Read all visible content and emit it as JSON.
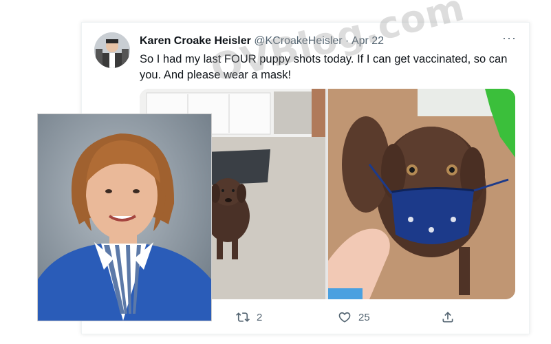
{
  "tweet": {
    "display_name": "Karen Croake Heisler",
    "handle": "@KCroakeHeisler",
    "separator": "·",
    "date": "Apr 22",
    "text": "So I had my last FOUR puppy shots today. If I can get vaccinated, so can you. And please wear a mask!",
    "more_icon": "···",
    "retweet_count": "2",
    "like_count": "25"
  },
  "icons": {
    "more": "more-icon",
    "retweet": "retweet-icon",
    "like": "heart-icon",
    "share": "share-icon"
  },
  "watermark": "OVBlog.com",
  "colors": {
    "text_primary": "#0f1419",
    "text_secondary": "#536471",
    "mask": "#1c3a8a",
    "puppy": "#4a3127",
    "cardigan": "#2a5cb8"
  }
}
